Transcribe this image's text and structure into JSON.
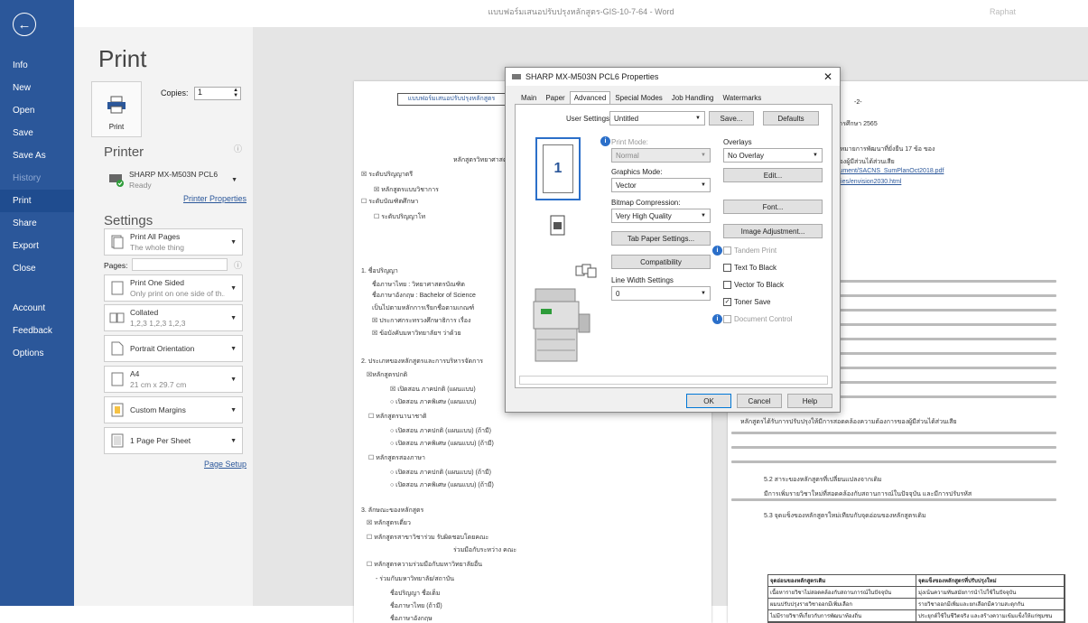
{
  "window": {
    "title": "แบบฟอร์มเสนอปรับปรุงหลักสูตร-GIS-10-7-64 - Word",
    "user": "Raphat"
  },
  "nav": {
    "items": [
      "Info",
      "New",
      "Open",
      "Save",
      "Save As",
      "History",
      "Print",
      "Share",
      "Export",
      "Close"
    ],
    "bottom": [
      "Account",
      "Feedback",
      "Options"
    ]
  },
  "print": {
    "heading": "Print",
    "print_button": "Print",
    "copies_label": "Copies:",
    "copies_value": "1",
    "printer_heading": "Printer",
    "printer_name": "SHARP MX-M503N PCL6",
    "printer_status": "Ready",
    "printer_properties": "Printer Properties",
    "settings_heading": "Settings",
    "pages_label": "Pages:",
    "page_setup": "Page Setup",
    "settings": [
      {
        "t1": "Print All Pages",
        "t2": "The whole thing"
      },
      {
        "t1": "Print One Sided",
        "t2": "Only print on one side of th..."
      },
      {
        "t1": "Collated",
        "t2": "1,2,3   1,2,3   1,2,3"
      },
      {
        "t1": "Portrait Orientation",
        "t2": ""
      },
      {
        "t1": "A4",
        "t2": "21 cm x 29.7 cm"
      },
      {
        "t1": "Custom Margins",
        "t2": ""
      },
      {
        "t1": "1 Page Per Sheet",
        "t2": ""
      }
    ]
  },
  "dialog": {
    "title": "SHARP MX-M503N PCL6 Properties",
    "tabs": [
      "Main",
      "Paper",
      "Advanced",
      "Special Modes",
      "Job Handling",
      "Watermarks"
    ],
    "user_settings_label": "User Settings:",
    "user_settings_value": "Untitled",
    "save": "Save...",
    "defaults": "Defaults",
    "print_mode_label": "Print Mode:",
    "print_mode_value": "Normal",
    "graphics_mode_label": "Graphics Mode:",
    "graphics_mode_value": "Vector",
    "bitmap_label": "Bitmap Compression:",
    "bitmap_value": "Very High Quality",
    "tab_paper": "Tab Paper Settings...",
    "compatibility": "Compatibility",
    "line_width_label": "Line Width Settings",
    "line_width_value": "0",
    "overlays_label": "Overlays",
    "overlays_value": "No Overlay",
    "edit": "Edit...",
    "font": "Font...",
    "image_adjust": "Image Adjustment...",
    "tandem": "Tandem Print",
    "text_black": "Text To Black",
    "vector_black": "Vector To Black",
    "toner_save": "Toner Save",
    "document_control": "Document Control",
    "ok": "OK",
    "cancel": "Cancel",
    "help": "Help",
    "preview_number": "1"
  },
  "doc_left": {
    "header": "แบบฟอร์มเสนอปรับปรุงหลักสูตร",
    "lines": [
      "หลักสูตรวิทยาศาสตรบัณฑิต",
      "☒ ระดับปริญญาตรี",
      "☒ หลักสูตรแบบวิชาการ",
      "☐ ระดับบัณฑิตศึกษา",
      "☐ ระดับปริญญาโท",
      "คณะเทคโน",
      "1. ชื่อปริญญา",
      "ชื่อภาษาไทย : วิทยาศาสตรบัณฑิต",
      "ชื่อภาษาอังกฤษ : Bachelor of Science",
      "เป็นไปตามหลักการเรียกชื่อตามเกณฑ์",
      "☒ ประกาศกระทรวงศึกษาธิการ เรื่อง",
      "☒ ข้อบังคับมหาวิทยาลัยฯ ว่าด้วย",
      "2. ประเภทของหลักสูตรและการบริหารจัดการ",
      "☒หลักสูตรปกติ",
      "☒ เปิดสอน ภาคปกติ (แผนแบบ)",
      "○ เปิดสอน ภาคพิเศษ (แผนแบบ)",
      "☐ หลักสูตรนานาชาติ",
      "○ เปิดสอน ภาคปกติ (แผนแบบ) (ถ้ามี)",
      "○ เปิดสอน ภาคพิเศษ (แผนแบบ) (ถ้ามี)",
      "☐ หลักสูตรสองภาษา",
      "○ เปิดสอน ภาคปกติ (แผนแบบ) (ถ้ามี)",
      "○ เปิดสอน ภาคพิเศษ (แผนแบบ) (ถ้ามี)",
      "3. ลักษณะของหลักสูตร",
      "☒ หลักสูตรเดี่ยว",
      "☐ หลักสูตรสาขาวิชาร่วม รับผิดชอบโดยคณะ",
      "ร่วมมือกับระหว่าง คณะ",
      "☐ หลักสูตรความร่วมมือกับมหาวิทยาลัยอื่น",
      "- ร่วมกับมหาวิทยาลัย/สถาบัน",
      "ชื่อปริญญา ชื่อเต็ม",
      "ชื่อภาษาไทย (ถ้ามี)",
      "ชื่อภาษาอังกฤษ"
    ]
  },
  "doc_right": {
    "lines": [
      "สูตรปรับปรุง ตั้งแต่ภาคการศึกษาที่ 1 ปีการศึกษา 2565",
      "การปรับปรุงหลักสูตร",
      "บายและยุทธศาสตร์ชาติ 6 ประการ / เป้าหมายการพัฒนาที่ยั่งยืน 17 ข้อ ของ",
      "อยุทธ์ของมหาวิทยาลัย / ความต้องการของผู้มีส่วนได้ส่วนเสีย",
      "https://www.nesdb.go.th/download/document/SACNS_SumPlanOct2018.pdf",
      "www.un.org/development/desa/disabilities/envision2030.html",
      "โยบายและยุทธศาสตร์ชาติ",
      "มยุทธศาสตร์ชาติ...",
      "2. การพัฒนาที่ยั่งยืน SDGs",
      "ห่างเครื่องมือที่สำคัญที่จะนำไปสู่...",
      "การเปลี่ยนแปลงของบริบทสังคม...",
      "หลักสูตรได้รับการปรับปรุงให้มีการสอดคล้องความต้องการของผู้มีส่วนได้ส่วนเสีย",
      "5.2 สาระของหลักสูตรที่เปลี่ยนแปลงจากเดิม",
      "มีการเพิ่มรายวิชาใหม่ที่สอดคล้องกับสถานการณ์ในปัจจุบัน และมีการปรับรหัส",
      "5.3 จุดแข็งของหลักสูตรใหม่เทียบกับจุดอ่อนของหลักสูตรเดิม"
    ],
    "table_header": [
      "จุดอ่อนของหลักสูตรเดิม",
      "จุดแข็งของหลักสูตรที่ปรับปรุงใหม่"
    ],
    "table_rows": [
      [
        "เนื้อหารายวิชาไม่สอดคล้องกับสถานการณ์ในปัจจุบัน",
        "มุ่งเน้นความทันสมัยการนำไปใช้ในปัจจุบัน"
      ],
      [
        "ผมนปรับปรุงรายวิชาออกมีเพิ่มเลือก",
        "รายวิชาออกมีเพิ่มและยกเลือกมีความสะดุกกัน"
      ],
      [
        "ไม่มีรายวิชาที่เกี่ยวกับการพัฒนาท้องถิ่น",
        "ประยุกต์ใช้ในชีวิตจริง และสร้างความเข้มแข็งให้แก่ชุมชน"
      ]
    ]
  }
}
